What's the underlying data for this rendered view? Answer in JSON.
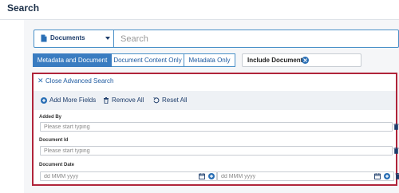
{
  "header": {
    "title": "Search"
  },
  "search": {
    "doc_type_label": "Documents",
    "placeholder": "Search"
  },
  "mode_tabs": [
    {
      "label": "Metadata and Document",
      "active": true
    },
    {
      "label": "Document Content Only",
      "active": false
    },
    {
      "label": "Metadata Only",
      "active": false
    }
  ],
  "include_documents": {
    "label": "Include Documents"
  },
  "advanced": {
    "close_label": "Close Advanced Search",
    "actions": {
      "add_more": "Add More Fields",
      "remove_all": "Remove All",
      "reset_all": "Reset All"
    },
    "fields": [
      {
        "label": "Added By",
        "placeholder": "Please start typing"
      },
      {
        "label": "Document Id",
        "placeholder": "Please start typing"
      },
      {
        "label": "Document Date",
        "from_placeholder": "dd MMM yyyy",
        "to_placeholder": "dd MMM yyyy"
      }
    ]
  },
  "colors": {
    "accent": "#3a7cc1",
    "panel_border": "#b0243a",
    "link": "#1e5aa0"
  }
}
